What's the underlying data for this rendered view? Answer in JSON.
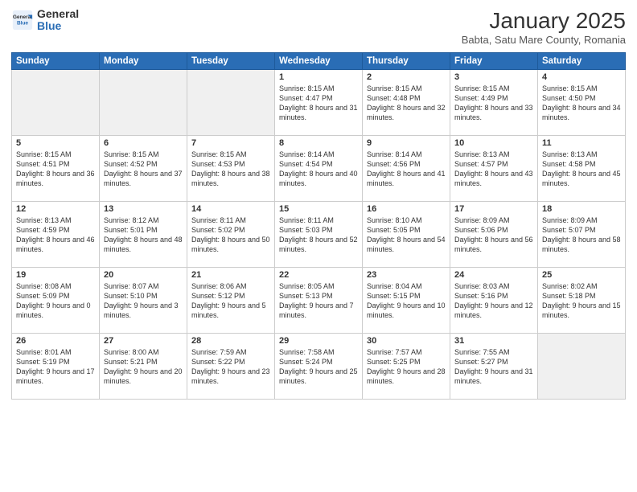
{
  "header": {
    "logo_general": "General",
    "logo_blue": "Blue",
    "month_title": "January 2025",
    "subtitle": "Babta, Satu Mare County, Romania"
  },
  "days_of_week": [
    "Sunday",
    "Monday",
    "Tuesday",
    "Wednesday",
    "Thursday",
    "Friday",
    "Saturday"
  ],
  "weeks": [
    [
      {
        "day": "",
        "empty": true
      },
      {
        "day": "",
        "empty": true
      },
      {
        "day": "",
        "empty": true
      },
      {
        "day": "1",
        "sunrise": "8:15 AM",
        "sunset": "4:47 PM",
        "daylight": "8 hours and 31 minutes."
      },
      {
        "day": "2",
        "sunrise": "8:15 AM",
        "sunset": "4:48 PM",
        "daylight": "8 hours and 32 minutes."
      },
      {
        "day": "3",
        "sunrise": "8:15 AM",
        "sunset": "4:49 PM",
        "daylight": "8 hours and 33 minutes."
      },
      {
        "day": "4",
        "sunrise": "8:15 AM",
        "sunset": "4:50 PM",
        "daylight": "8 hours and 34 minutes."
      }
    ],
    [
      {
        "day": "5",
        "sunrise": "8:15 AM",
        "sunset": "4:51 PM",
        "daylight": "8 hours and 36 minutes."
      },
      {
        "day": "6",
        "sunrise": "8:15 AM",
        "sunset": "4:52 PM",
        "daylight": "8 hours and 37 minutes."
      },
      {
        "day": "7",
        "sunrise": "8:15 AM",
        "sunset": "4:53 PM",
        "daylight": "8 hours and 38 minutes."
      },
      {
        "day": "8",
        "sunrise": "8:14 AM",
        "sunset": "4:54 PM",
        "daylight": "8 hours and 40 minutes."
      },
      {
        "day": "9",
        "sunrise": "8:14 AM",
        "sunset": "4:56 PM",
        "daylight": "8 hours and 41 minutes."
      },
      {
        "day": "10",
        "sunrise": "8:13 AM",
        "sunset": "4:57 PM",
        "daylight": "8 hours and 43 minutes."
      },
      {
        "day": "11",
        "sunrise": "8:13 AM",
        "sunset": "4:58 PM",
        "daylight": "8 hours and 45 minutes."
      }
    ],
    [
      {
        "day": "12",
        "sunrise": "8:13 AM",
        "sunset": "4:59 PM",
        "daylight": "8 hours and 46 minutes."
      },
      {
        "day": "13",
        "sunrise": "8:12 AM",
        "sunset": "5:01 PM",
        "daylight": "8 hours and 48 minutes."
      },
      {
        "day": "14",
        "sunrise": "8:11 AM",
        "sunset": "5:02 PM",
        "daylight": "8 hours and 50 minutes."
      },
      {
        "day": "15",
        "sunrise": "8:11 AM",
        "sunset": "5:03 PM",
        "daylight": "8 hours and 52 minutes."
      },
      {
        "day": "16",
        "sunrise": "8:10 AM",
        "sunset": "5:05 PM",
        "daylight": "8 hours and 54 minutes."
      },
      {
        "day": "17",
        "sunrise": "8:09 AM",
        "sunset": "5:06 PM",
        "daylight": "8 hours and 56 minutes."
      },
      {
        "day": "18",
        "sunrise": "8:09 AM",
        "sunset": "5:07 PM",
        "daylight": "8 hours and 58 minutes."
      }
    ],
    [
      {
        "day": "19",
        "sunrise": "8:08 AM",
        "sunset": "5:09 PM",
        "daylight": "9 hours and 0 minutes."
      },
      {
        "day": "20",
        "sunrise": "8:07 AM",
        "sunset": "5:10 PM",
        "daylight": "9 hours and 3 minutes."
      },
      {
        "day": "21",
        "sunrise": "8:06 AM",
        "sunset": "5:12 PM",
        "daylight": "9 hours and 5 minutes."
      },
      {
        "day": "22",
        "sunrise": "8:05 AM",
        "sunset": "5:13 PM",
        "daylight": "9 hours and 7 minutes."
      },
      {
        "day": "23",
        "sunrise": "8:04 AM",
        "sunset": "5:15 PM",
        "daylight": "9 hours and 10 minutes."
      },
      {
        "day": "24",
        "sunrise": "8:03 AM",
        "sunset": "5:16 PM",
        "daylight": "9 hours and 12 minutes."
      },
      {
        "day": "25",
        "sunrise": "8:02 AM",
        "sunset": "5:18 PM",
        "daylight": "9 hours and 15 minutes."
      }
    ],
    [
      {
        "day": "26",
        "sunrise": "8:01 AM",
        "sunset": "5:19 PM",
        "daylight": "9 hours and 17 minutes."
      },
      {
        "day": "27",
        "sunrise": "8:00 AM",
        "sunset": "5:21 PM",
        "daylight": "9 hours and 20 minutes."
      },
      {
        "day": "28",
        "sunrise": "7:59 AM",
        "sunset": "5:22 PM",
        "daylight": "9 hours and 23 minutes."
      },
      {
        "day": "29",
        "sunrise": "7:58 AM",
        "sunset": "5:24 PM",
        "daylight": "9 hours and 25 minutes."
      },
      {
        "day": "30",
        "sunrise": "7:57 AM",
        "sunset": "5:25 PM",
        "daylight": "9 hours and 28 minutes."
      },
      {
        "day": "31",
        "sunrise": "7:55 AM",
        "sunset": "5:27 PM",
        "daylight": "9 hours and 31 minutes."
      },
      {
        "day": "",
        "empty": true
      }
    ]
  ]
}
